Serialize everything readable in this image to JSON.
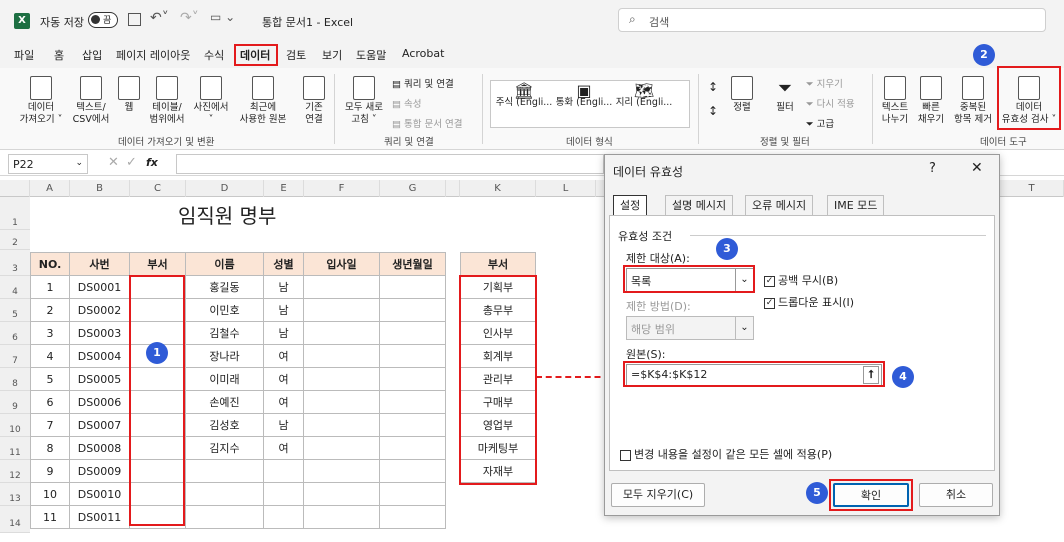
{
  "titlebar": {
    "app_icon": "excel-icon",
    "autosave_label": "자동 저장",
    "autosave_state": "끔",
    "doc_title": "통합 문서1  -  Excel",
    "search_placeholder": "검색"
  },
  "menu": [
    "파일",
    "홈",
    "삽입",
    "페이지 레이아웃",
    "수식",
    "데이터",
    "검토",
    "보기",
    "도움말",
    "Acrobat"
  ],
  "ribbon": {
    "btn_get_data": "데이터\n가져오기 ˅",
    "btn_text_csv": "텍스트/\nCSV에서",
    "btn_web": "웹",
    "btn_table_range": "테이블/\n범위에서",
    "btn_from_picture": "사진에서\n˅",
    "btn_recent": "최근에\n사용한 원본",
    "btn_existing": "기존\n연결",
    "group_get_transform": "데이터 가져오기 및 변환",
    "btn_refresh_all": "모두 새로\n고침 ˅",
    "btn_queries_connections": "쿼리 및 연결",
    "btn_properties": "속성",
    "btn_edit_links": "통합 문서 연결",
    "group_queries": "쿼리 및 연결",
    "btn_stocks": "주식 (Engli...",
    "btn_currency": "통화 (Engli...",
    "btn_geography": "지리 (Engli...",
    "group_data_types": "데이터 형식",
    "btn_sort": "정렬",
    "btn_filter": "필터",
    "btn_clear": "지우기",
    "btn_reapply": "다시 적용",
    "btn_advanced": "고급",
    "group_sort_filter": "정렬 및 필터",
    "btn_text_to_columns": "텍스트\n나누기",
    "btn_flash_fill": "빠른\n채우기",
    "btn_remove_duplicates": "중복된\n항목 제거",
    "btn_data_validation": "데이터\n유효성 검사 ˅",
    "group_data_tools": "데이터 도구"
  },
  "formula_bar": {
    "name_box": "P22",
    "fx": "fx"
  },
  "columns": [
    "A",
    "B",
    "C",
    "D",
    "E",
    "F",
    "G",
    "",
    "J",
    "K",
    "L",
    "",
    "",
    "",
    "",
    "T"
  ],
  "rows": [
    "1",
    "2",
    "3",
    "4",
    "5",
    "6",
    "7",
    "8",
    "9",
    "10",
    "11",
    "12",
    "13",
    "14"
  ],
  "sheet": {
    "title": "임직원 명부",
    "headers": [
      "NO.",
      "사번",
      "부서",
      "이름",
      "성별",
      "입사일",
      "생년월일"
    ],
    "records": [
      {
        "no": "1",
        "id": "DS0001",
        "name": "홍길동",
        "gender": "남"
      },
      {
        "no": "2",
        "id": "DS0002",
        "name": "이민호",
        "gender": "남"
      },
      {
        "no": "3",
        "id": "DS0003",
        "name": "김철수",
        "gender": "남"
      },
      {
        "no": "4",
        "id": "DS0004",
        "name": "장나라",
        "gender": "여"
      },
      {
        "no": "5",
        "id": "DS0005",
        "name": "이미래",
        "gender": "여"
      },
      {
        "no": "6",
        "id": "DS0006",
        "name": "손예진",
        "gender": "여"
      },
      {
        "no": "7",
        "id": "DS0007",
        "name": "김성호",
        "gender": "남"
      },
      {
        "no": "8",
        "id": "DS0008",
        "name": "김지수",
        "gender": "여"
      },
      {
        "no": "9",
        "id": "DS0009",
        "name": "",
        "gender": ""
      },
      {
        "no": "10",
        "id": "DS0010",
        "name": "",
        "gender": ""
      },
      {
        "no": "11",
        "id": "DS0011",
        "name": "",
        "gender": ""
      }
    ],
    "dept_header": "부서",
    "depts": [
      "기획부",
      "총무부",
      "인사부",
      "회계부",
      "관리부",
      "구매부",
      "영업부",
      "마케팅부",
      "자재부"
    ]
  },
  "dialog": {
    "title": "데이터 유효성",
    "help": "?",
    "close": "✕",
    "tabs": [
      "설정",
      "설명 메시지",
      "오류 메시지",
      "IME 모드"
    ],
    "criteria_label": "유효성 조건",
    "allow_label": "제한 대상(A):",
    "allow_value": "목록",
    "ignore_blank": "공백 무시(B)",
    "in_cell_dropdown": "드롭다운 표시(I)",
    "data_label": "제한 방법(D):",
    "data_value": "해당 범위",
    "source_label": "원본(S):",
    "source_value": "=$K$4:$K$12",
    "apply_all": "변경 내용을 설정이 같은 모든 셀에 적용(P)",
    "clear_all": "모두 지우기(C)",
    "ok": "확인",
    "cancel": "취소"
  },
  "badges": [
    "1",
    "2",
    "3",
    "4",
    "5"
  ],
  "colors": {
    "accent": "#e31a1c",
    "badge": "#2f5bd7",
    "header_fill": "#fbe5d6",
    "excel_green": "#1d6f42"
  }
}
